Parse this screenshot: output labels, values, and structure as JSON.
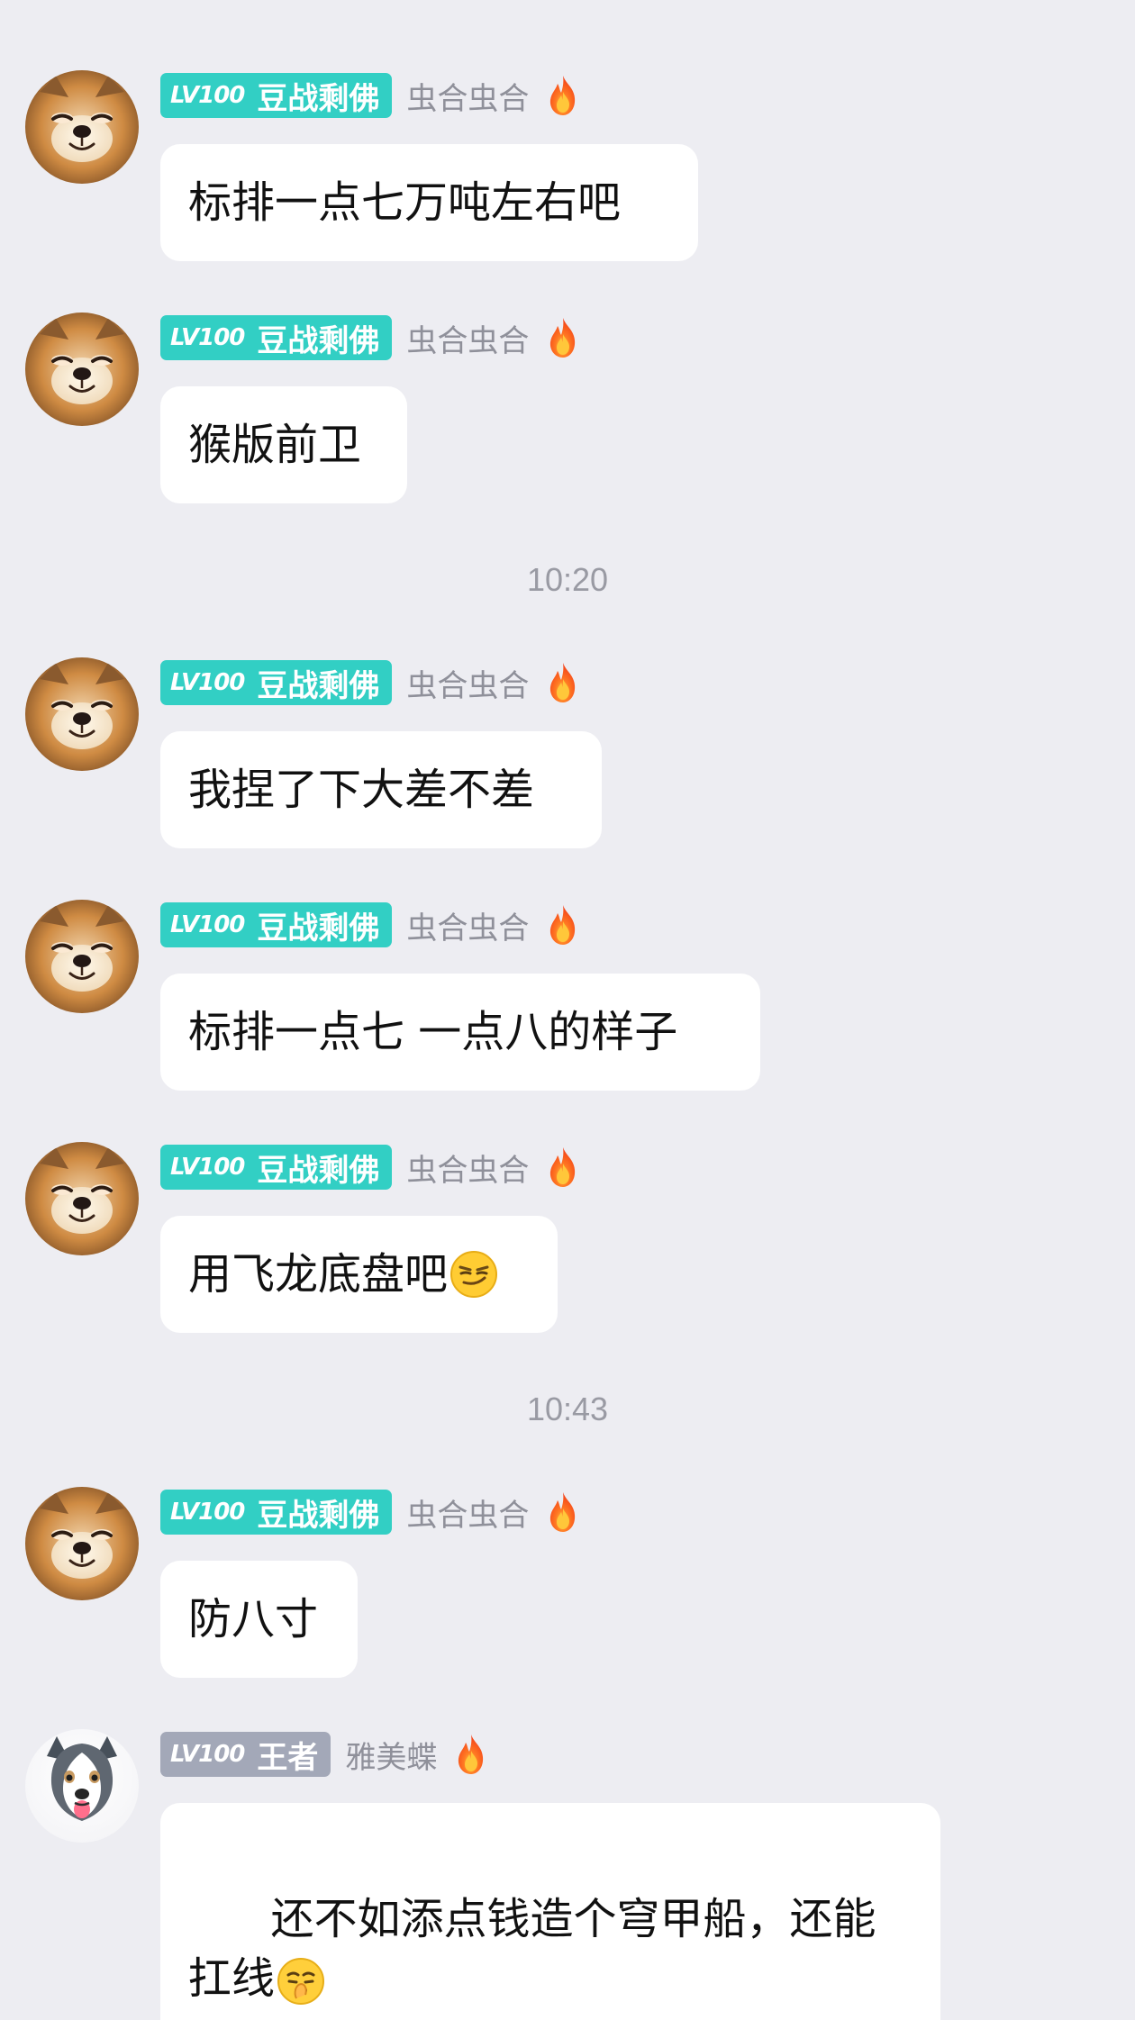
{
  "app": {
    "screen": "group-chat",
    "background_color": "#ededf2"
  },
  "timestamps": [
    "10:20",
    "10:43"
  ],
  "badge_colors": {
    "teal": "#32cfc4",
    "gray": "#a3a8b8"
  },
  "messages": [
    {
      "badge_level": "LV100",
      "badge_title": "豆战剩佛",
      "username": "虫合虫合",
      "text": "标排一点七万吨左右吧",
      "avatar": "shiba-avatar"
    },
    {
      "badge_level": "LV100",
      "badge_title": "豆战剩佛",
      "username": "虫合虫合",
      "text": "猴版前卫",
      "avatar": "shiba-avatar"
    },
    {
      "badge_level": "LV100",
      "badge_title": "豆战剩佛",
      "username": "虫合虫合",
      "text": "我捏了下大差不差",
      "avatar": "shiba-avatar"
    },
    {
      "badge_level": "LV100",
      "badge_title": "豆战剩佛",
      "username": "虫合虫合",
      "text": "标排一点七 一点八的样子",
      "avatar": "shiba-avatar"
    },
    {
      "badge_level": "LV100",
      "badge_title": "豆战剩佛",
      "username": "虫合虫合",
      "text": "用飞龙底盘吧",
      "emoji": "smirk-emoji",
      "avatar": "shiba-avatar"
    },
    {
      "badge_level": "LV100",
      "badge_title": "豆战剩佛",
      "username": "虫合虫合",
      "text": "防八寸",
      "avatar": "shiba-avatar"
    },
    {
      "badge_level": "LV100",
      "badge_title": "王者",
      "username": "雅美蝶",
      "text": "还不如添点钱造个穹甲船，还能\n扛线",
      "emoji": "shushing-face-emoji",
      "avatar": "husky-avatar"
    }
  ]
}
